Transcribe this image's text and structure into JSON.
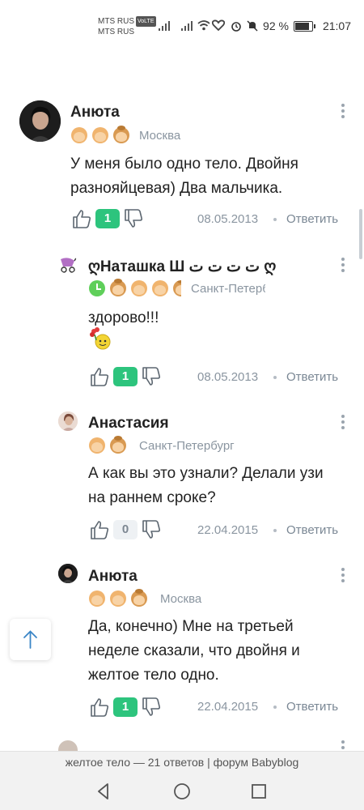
{
  "status_bar": {
    "carrier1": "MTS RUS",
    "carrier1_badge": "VoLTE",
    "carrier2": "MTS RUS",
    "battery_percent_label": "92 %",
    "battery_level": 0.92,
    "time": "21:07"
  },
  "comments": [
    {
      "author": "Анюта",
      "city": "Москва",
      "children": [
        "boy-icon",
        "boy-icon",
        "girl-icon"
      ],
      "text_lines": [
        "У меня было одно тело. Двойня",
        "разнояйцевая) Два мальчика."
      ],
      "likes": "1",
      "date": "08.05.2013",
      "reply_label": "Ответить"
    },
    {
      "author": "ღНаташка Ш ت ت ت ت ღ",
      "city": "Санкт-Петербург",
      "children": [
        "clock-icon",
        "girl-icon",
        "boy-icon",
        "boy-icon",
        "girl-icon"
      ],
      "text_lines": [
        "здорово!!!"
      ],
      "emoji": "flowers-smiley-emoji",
      "likes": "1",
      "date": "08.05.2013",
      "reply_label": "Ответить"
    },
    {
      "author": "Анастасия",
      "city": "Санкт-Петербург",
      "children": [
        "boy-icon",
        "girl-icon"
      ],
      "text_lines": [
        "А как вы это узнали? Делали узи",
        "на раннем сроке?"
      ],
      "likes": "0",
      "date": "22.04.2015",
      "reply_label": "Ответить"
    },
    {
      "author": "Анюта",
      "city": "Москва",
      "children": [
        "boy-icon",
        "boy-icon",
        "girl-icon"
      ],
      "text_lines": [
        "Да, конечно) Мне на третьей",
        "неделе сказали, что двойня и",
        "желтое тело одно."
      ],
      "likes": "1",
      "date": "22.04.2015",
      "reply_label": "Ответить"
    }
  ],
  "page_title": "желтое тело — 21 ответов | форум Babyblog",
  "icons": {
    "scroll_up": "arrow-up-icon",
    "like": "thumb-up-icon",
    "dislike": "thumb-down-icon",
    "menu": "kebab-menu-icon"
  },
  "colors": {
    "likes_positive": "#2dc47d",
    "likes_zero": "#eef1f4",
    "meta_gray": "#8a95a0"
  }
}
